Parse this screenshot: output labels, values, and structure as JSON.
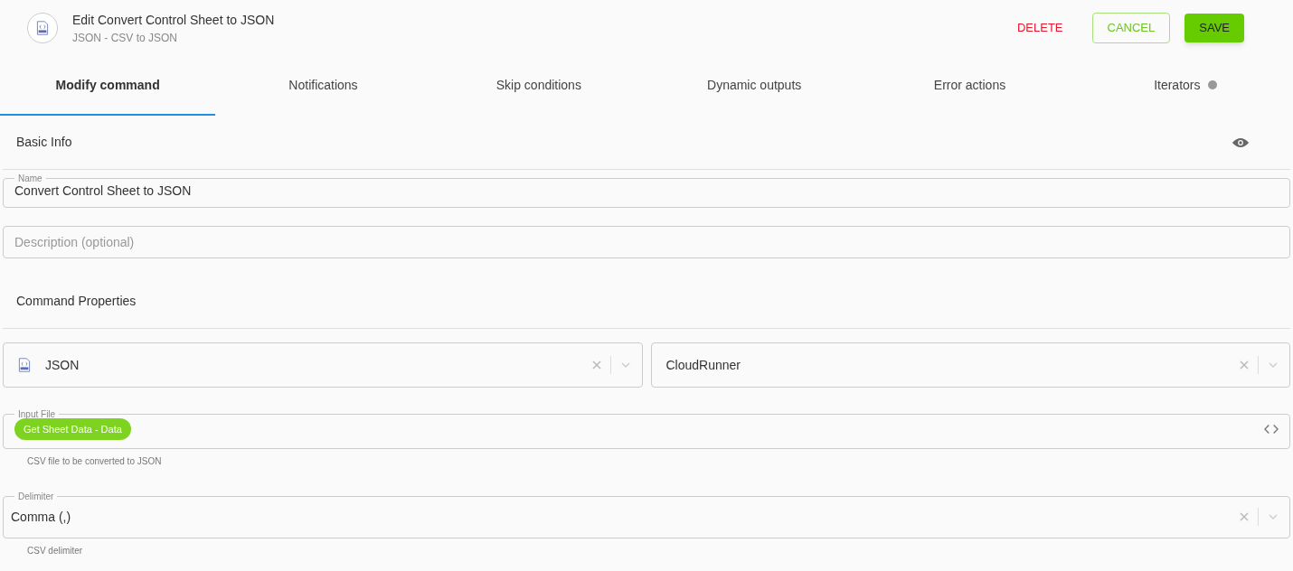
{
  "header": {
    "title": "Edit Convert Control Sheet to JSON",
    "subtitle": "JSON - CSV to JSON",
    "actions": [
      {
        "label": "DELETE",
        "kind": "text"
      },
      {
        "label": "CANCEL",
        "kind": "outline"
      },
      {
        "label": "SAVE",
        "kind": "filled"
      }
    ]
  },
  "tabs": [
    {
      "label": "Modify command",
      "selected": true
    },
    {
      "label": "Notifications",
      "selected": false
    },
    {
      "label": "Skip conditions",
      "selected": false
    },
    {
      "label": "Dynamic outputs",
      "selected": false
    },
    {
      "label": "Error actions",
      "selected": false
    },
    {
      "label": "Iterators",
      "selected": false
    }
  ],
  "basic_info": {
    "title": "Basic Info",
    "name": {
      "label": "Name",
      "value": "Convert Control Sheet to JSON"
    },
    "description": {
      "placeholder": "Description (optional)"
    }
  },
  "command_properties": {
    "title": "Command Properties",
    "selects": [
      {
        "value": "JSON",
        "icon": true
      },
      {
        "value": "CloudRunner",
        "icon": false
      }
    ],
    "input_file": {
      "label": "Input File",
      "chip": "Get Sheet Data - Data",
      "helper": "CSV file to be converted to JSON"
    },
    "delimiter": {
      "label": "Delimiter",
      "value": "Comma (,)",
      "helper": "CSV delimiter"
    }
  }
}
